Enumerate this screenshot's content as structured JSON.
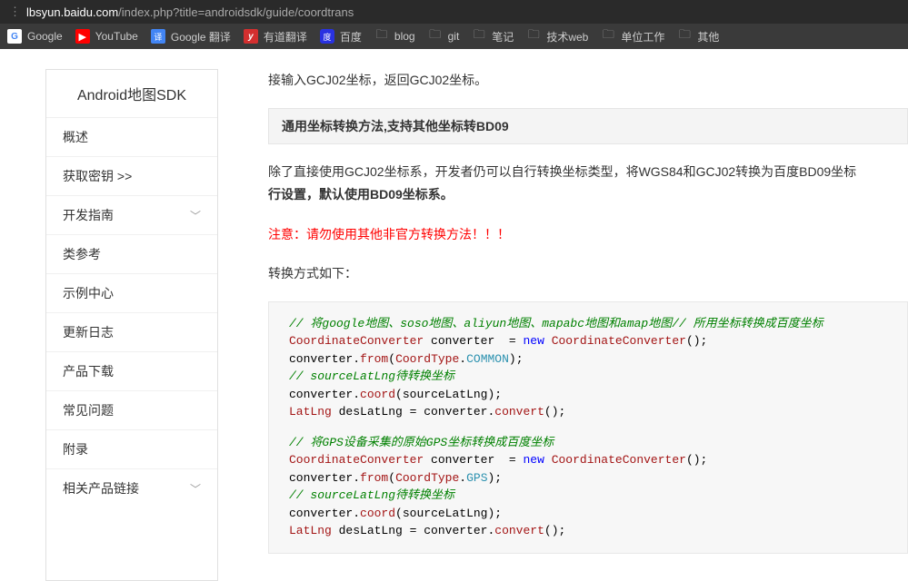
{
  "browser": {
    "urlHost": "lbsyun.baidu.com",
    "urlPath": "/index.php?title=androidsdk/guide/coordtrans"
  },
  "bookmarks": [
    {
      "label": "Google",
      "icon": "google"
    },
    {
      "label": "YouTube",
      "icon": "youtube"
    },
    {
      "label": "Google 翻译",
      "icon": "translate"
    },
    {
      "label": "有道翻译",
      "icon": "youdao"
    },
    {
      "label": "百度",
      "icon": "baidu"
    },
    {
      "label": "blog",
      "icon": "folder"
    },
    {
      "label": "git",
      "icon": "folder"
    },
    {
      "label": "笔记",
      "icon": "folder"
    },
    {
      "label": "技术web",
      "icon": "folder"
    },
    {
      "label": "单位工作",
      "icon": "folder"
    },
    {
      "label": "其他",
      "icon": "folder"
    }
  ],
  "sidebar": {
    "title": "Android地图SDK",
    "items": [
      {
        "label": "概述",
        "chev": false
      },
      {
        "label": "获取密钥 >>",
        "chev": false
      },
      {
        "label": "开发指南",
        "chev": true
      },
      {
        "label": "类参考",
        "chev": false
      },
      {
        "label": "示例中心",
        "chev": false
      },
      {
        "label": "更新日志",
        "chev": false
      },
      {
        "label": "产品下载",
        "chev": false
      },
      {
        "label": "常见问题",
        "chev": false
      },
      {
        "label": "附录",
        "chev": false
      },
      {
        "label": "相关产品链接",
        "chev": true
      }
    ]
  },
  "content": {
    "intro": "接输入GCJ02坐标，返回GCJ02坐标。",
    "sectionTitle": "通用坐标转换方法,支持其他坐标转BD09",
    "para1a": "除了直接使用GCJ02坐标系，开发者仍可以自行转换坐标类型，将WGS84和GCJ02转换为百度BD09坐标",
    "para1b": "行设置，默认使用BD09坐标系。",
    "warning": "注意：请勿使用其他非官方转换方法！！！",
    "para2": "转换方式如下：",
    "code": {
      "l1": {
        "comment": "// 将google地图、soso地图、aliyun地图、mapabc地图和amap地图// 所用坐标转换成百度坐标"
      },
      "l2": {
        "t1": "CoordinateConverter",
        "t2": " converter  ",
        "t3": "=",
        "t4": " ",
        "t5": "new",
        "t6": " ",
        "t7": "CoordinateConverter",
        "t8": "();"
      },
      "l3": {
        "t1": "converter",
        "t2": ".",
        "t3": "from",
        "t4": "(",
        "t5": "CoordType",
        "t6": ".",
        "t7": "COMMON",
        "t8": ");"
      },
      "l4": {
        "comment": "// sourceLatLng待转换坐标"
      },
      "l5": {
        "t1": "converter",
        "t2": ".",
        "t3": "coord",
        "t4": "(",
        "t5": "sourceLatLng",
        "t6": ");"
      },
      "l6": {
        "t1": "LatLng",
        "t2": " desLatLng ",
        "t3": "=",
        "t4": " converter",
        "t5": ".",
        "t6": "convert",
        "t7": "();"
      },
      "l7": {
        "comment": "// 将GPS设备采集的原始GPS坐标转换成百度坐标"
      },
      "l8": {
        "t1": "CoordinateConverter",
        "t2": " converter  ",
        "t3": "=",
        "t4": " ",
        "t5": "new",
        "t6": " ",
        "t7": "CoordinateConverter",
        "t8": "();"
      },
      "l9": {
        "t1": "converter",
        "t2": ".",
        "t3": "from",
        "t4": "(",
        "t5": "CoordType",
        "t6": ".",
        "t7": "GPS",
        "t8": ");"
      },
      "l10": {
        "comment": "// sourceLatLng待转换坐标"
      },
      "l11": {
        "t1": "converter",
        "t2": ".",
        "t3": "coord",
        "t4": "(",
        "t5": "sourceLatLng",
        "t6": ");"
      },
      "l12": {
        "t1": "LatLng",
        "t2": " desLatLng ",
        "t3": "=",
        "t4": " converter",
        "t5": ".",
        "t6": "convert",
        "t7": "();"
      }
    }
  }
}
